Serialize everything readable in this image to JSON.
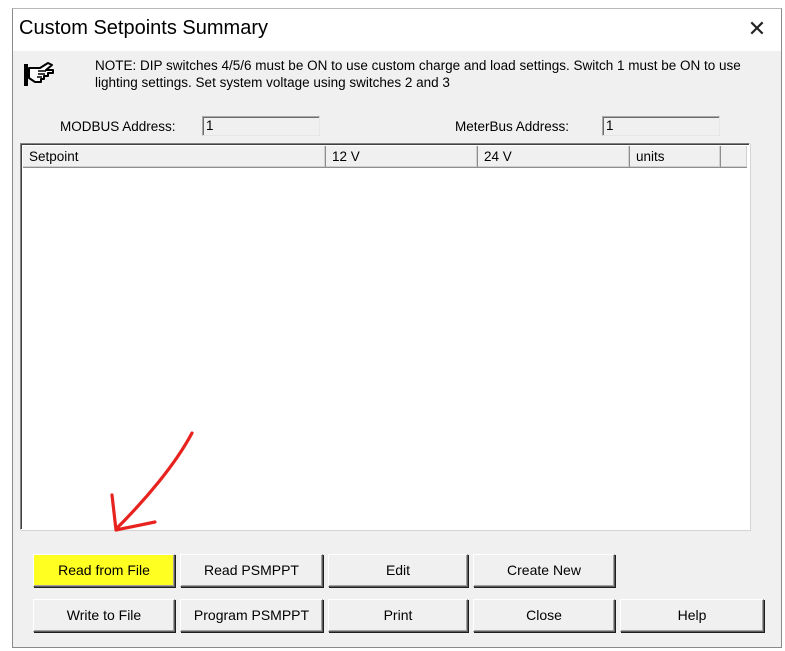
{
  "window": {
    "title": "Custom Setpoints Summary",
    "close_glyph": "✕"
  },
  "note": {
    "icon": "pointing-hand-icon",
    "text": "NOTE: DIP switches 4/5/6 must be ON to use custom charge and load settings. Switch 1 must be ON to use lighting settings. Set system voltage using switches 2 and 3"
  },
  "modbus": {
    "label": "MODBUS Address:",
    "value": "1"
  },
  "meterbus": {
    "label": "MeterBus Address:",
    "value": "1"
  },
  "table": {
    "columns": [
      "Setpoint",
      "12 V",
      "24 V",
      "units",
      ""
    ],
    "rows": []
  },
  "buttons": {
    "row1": [
      "Read from File",
      "Read PSMPPT",
      "Edit",
      "Create New"
    ],
    "row2": [
      "Write to File",
      "Program PSMPPT",
      "Print",
      "Close",
      "Help"
    ]
  },
  "annotation": {
    "arrow_color": "#e8221e",
    "highlight_color": "#ffff22"
  }
}
